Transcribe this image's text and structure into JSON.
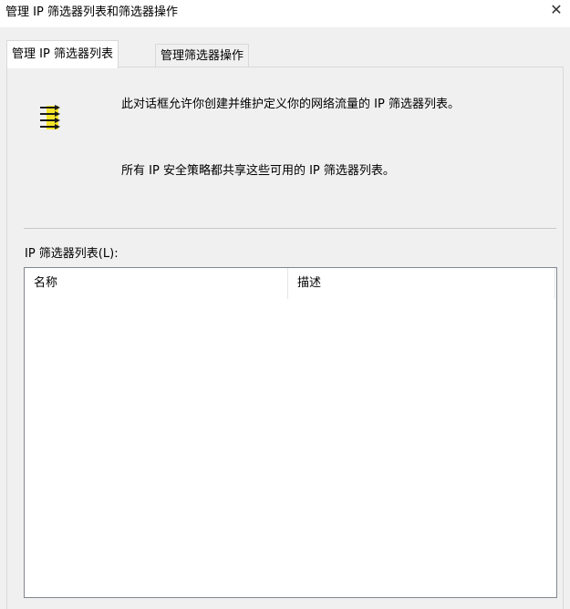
{
  "window": {
    "title": "管理 IP 筛选器列表和筛选器操作",
    "close_glyph": "✕"
  },
  "tabs": [
    {
      "label": "管理 IP 筛选器列表",
      "active": true
    },
    {
      "label": "管理筛选器操作",
      "active": false
    }
  ],
  "panel": {
    "description_1": "此对话框允许你创建并维护定义你的网络流量的 IP 筛选器列表。",
    "description_2": "所有 IP 安全策略都共享这些可用的 IP 筛选器列表。",
    "list_label": "IP 筛选器列表(L):",
    "list_columns": [
      "名称",
      "描述"
    ],
    "icon": "filter-list-icon"
  },
  "colors": {
    "icon_yellow": "#f5e52a",
    "icon_dark": "#1a1a1a",
    "accent_blue": "#1a5fb4"
  }
}
